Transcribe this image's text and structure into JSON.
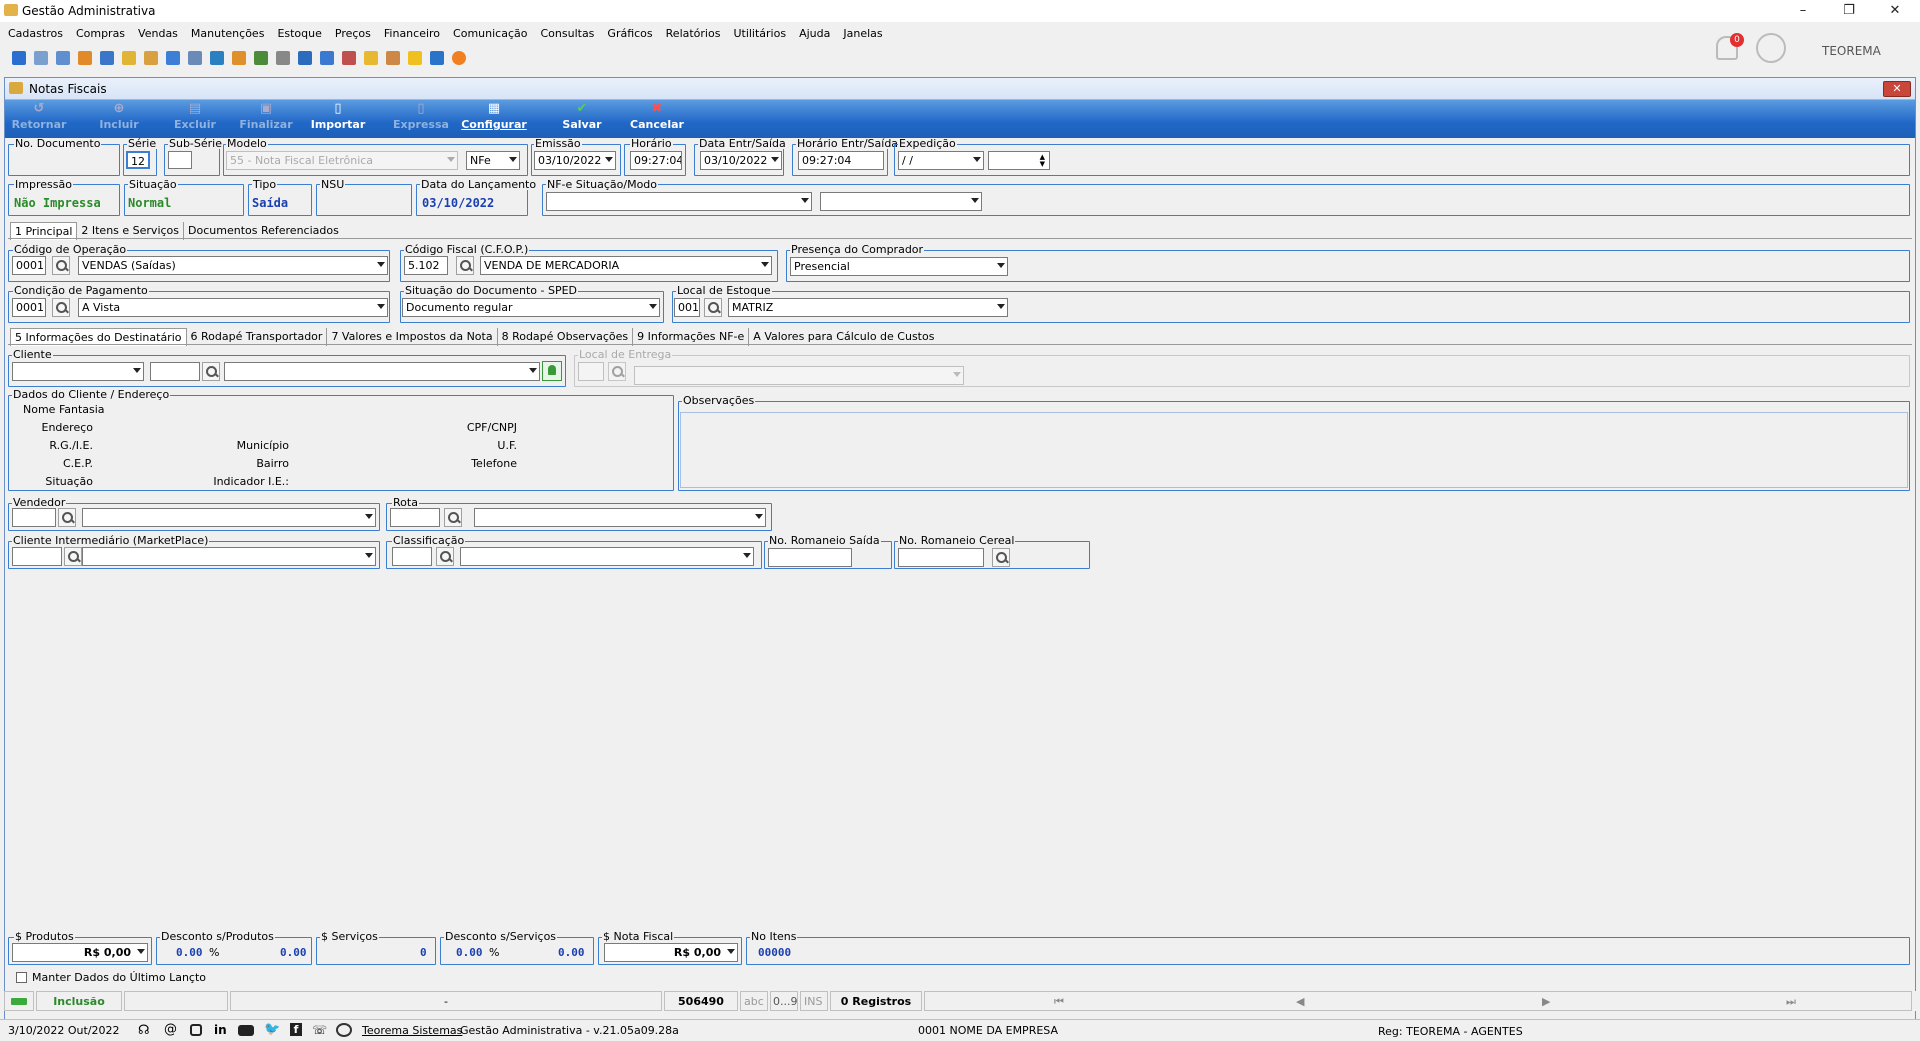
{
  "app": {
    "title": "Gestão Administrativa",
    "user": "TEOREMA",
    "notif_count": "0"
  },
  "menu": [
    "Cadastros",
    "Compras",
    "Vendas",
    "Manutenções",
    "Estoque",
    "Preços",
    "Financeiro",
    "Comunicação",
    "Consultas",
    "Gráficos",
    "Relatórios",
    "Utilitários",
    "Ajuda",
    "Janelas"
  ],
  "window": {
    "title": "Notas Fiscais"
  },
  "actions": {
    "retornar": "Retornar",
    "incluir": "Incluir",
    "excluir": "Excluir",
    "finalizar": "Finalizar",
    "importar": "Importar",
    "expressa": "Expressa",
    "configurar": "Configurar",
    "salvar": "Salvar",
    "cancelar": "Cancelar"
  },
  "header": {
    "no_documento_label": "No. Documento",
    "serie_label": "Série",
    "serie": "12",
    "subserie_label": "Sub-Série",
    "modelo_label": "Modelo",
    "modelo": "55 - Nota Fiscal Eletrônica",
    "modelo_tipo": "NFe",
    "emissao_label": "Emissão",
    "emissao": "03/10/2022",
    "horario_label": "Horário",
    "horario": "09:27:04",
    "data_entr_label": "Data Entr/Saída",
    "data_entr": "03/10/2022",
    "horario_entr_label": "Horário Entr/Saída",
    "horario_entr": "09:27:04",
    "expedicao_label": "Expedição",
    "expedicao": " /  /",
    "impressao_label": "Impressão",
    "impressao": "Não Impressa",
    "situacao_label": "Situação",
    "situacao": "Normal",
    "tipo_label": "Tipo",
    "tipo": "Saída",
    "nsu_label": "NSU",
    "data_lanc_label": "Data do Lançamento",
    "data_lanc": "03/10/2022",
    "nfe_label": "NF-e Situação/Modo"
  },
  "tabs1": [
    "1 Principal",
    "2 Itens e Serviços",
    "Documentos Referenciados"
  ],
  "principal": {
    "cod_op_label": "Código de Operação",
    "cod_op": "0001",
    "cod_op_desc": "VENDAS (Saídas)",
    "cfop_label": "Código Fiscal (C.F.O.P.)",
    "cfop": "5.102",
    "cfop_desc": "VENDA DE MERCADORIA",
    "presenca_label": "Presença do Comprador",
    "presenca": "Presencial",
    "cond_pag_label": "Condição de Pagamento",
    "cond_pag": "0001",
    "cond_pag_desc": "A Vista",
    "sit_doc_label": "Situação do Documento - SPED",
    "sit_doc": "Documento regular",
    "local_est_label": "Local de Estoque",
    "local_est": "001",
    "local_est_desc": "MATRIZ"
  },
  "tabs2": [
    "5 Informações do Destinatário",
    "6 Rodapé Transportador",
    "7 Valores e Impostos da Nota",
    "8 Rodapé Observações",
    "9 Informações NF-e",
    "A Valores para Cálculo de Custos"
  ],
  "dest": {
    "cliente_label": "Cliente",
    "local_entrega_label": "Local de Entrega",
    "dados_label": "Dados do Cliente / Endereço",
    "obs_label": "Observações",
    "fields_left": [
      "Nome Fantasia",
      "Endereço",
      "R.G./I.E.",
      "C.E.P.",
      "Situação"
    ],
    "fields_mid": [
      "Município",
      "Bairro",
      "Indicador I.E.:"
    ],
    "fields_right": [
      "CPF/CNPJ",
      "U.F.",
      "Telefone"
    ],
    "vendedor_label": "Vendedor",
    "rota_label": "Rota",
    "cli_inter_label": "Cliente Intermediário (MarketPlace)",
    "classif_label": "Classificação",
    "rom_saida_label": "No. Romaneio Saída",
    "rom_cereal_label": "No. Romaneio Cereal"
  },
  "totals": {
    "produtos_label": "$ Produtos",
    "produtos": "R$ 0,00",
    "desc_prod_label": "Desconto s/Produtos",
    "desc_prod_pct": "0.00",
    "desc_prod_val": "0.00",
    "servicos_label": "$ Serviços",
    "servicos": "0",
    "desc_serv_label": "Desconto s/Serviços",
    "desc_serv_pct": "0.00",
    "desc_serv_val": "0.00",
    "nota_label": "$ Nota Fiscal",
    "nota": "R$ 0,00",
    "itens_label": "No Itens",
    "itens": "00000",
    "pct": "%"
  },
  "manter_label": "Manter Dados do Último Lançto",
  "status": {
    "mode": "Inclusão",
    "dash": "-",
    "code": "506490",
    "abc": "abc",
    "num": "0...9",
    "ins": "INS",
    "registros": "0 Registros"
  },
  "footer": {
    "date": "3/10/2022 Out/2022",
    "company_link": "Teorema Sistemas",
    "version": "Gestão Administrativa - v.21.05a09.28a",
    "empresa": "0001 NOME DA EMPRESA",
    "reg": "Reg: TEOREMA - AGENTES"
  }
}
